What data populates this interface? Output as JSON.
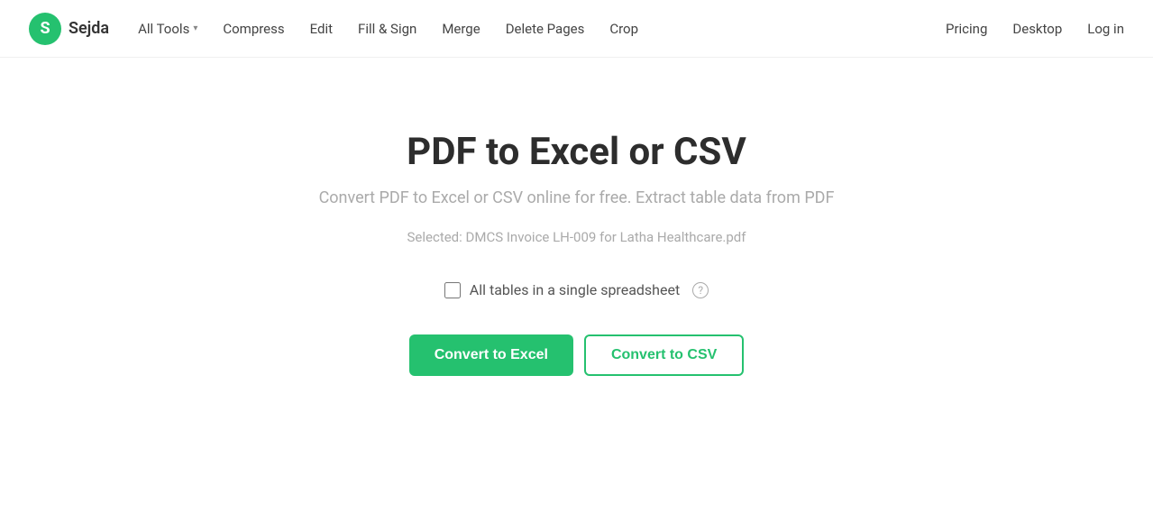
{
  "logo": {
    "icon_letter": "S",
    "name": "Sejda"
  },
  "navbar": {
    "left_links": [
      {
        "label": "All Tools",
        "has_chevron": true
      },
      {
        "label": "Compress",
        "has_chevron": false
      },
      {
        "label": "Edit",
        "has_chevron": false
      },
      {
        "label": "Fill & Sign",
        "has_chevron": false
      },
      {
        "label": "Merge",
        "has_chevron": false
      },
      {
        "label": "Delete Pages",
        "has_chevron": false
      },
      {
        "label": "Crop",
        "has_chevron": false
      }
    ],
    "right_links": [
      {
        "label": "Pricing"
      },
      {
        "label": "Desktop"
      },
      {
        "label": "Log in"
      }
    ]
  },
  "page": {
    "title": "PDF to Excel or CSV",
    "subtitle": "Convert PDF to Excel or CSV online for free. Extract table data from PDF",
    "selected_file_label": "Selected:",
    "selected_file_name": "DMCS Invoice LH-009 for Latha Healthcare.pdf",
    "checkbox_label": "All tables in a single spreadsheet",
    "btn_excel_label": "Convert to Excel",
    "btn_csv_label": "Convert to CSV"
  }
}
